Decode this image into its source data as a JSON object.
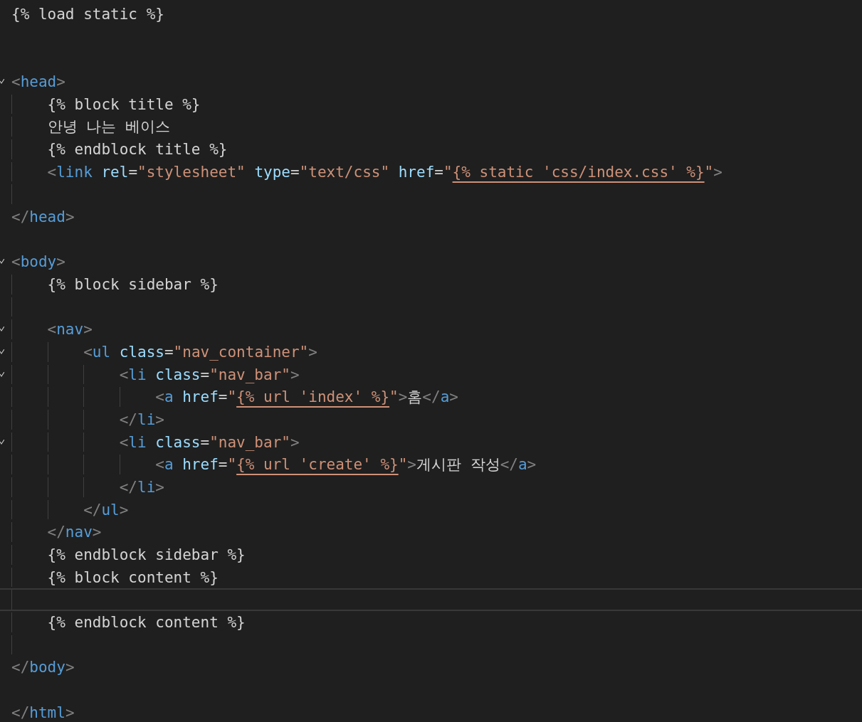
{
  "lines": [
    {
      "foldable": false,
      "current": false,
      "tokens": [
        {
          "kind": "template",
          "text": "{% load static %}"
        }
      ]
    },
    {
      "foldable": false,
      "current": false
    },
    {
      "foldable": false,
      "current": false
    },
    {
      "foldable": true,
      "current": false,
      "tokens": [
        {
          "kind": "bracket",
          "text": "<"
        },
        {
          "kind": "tag",
          "text": "head"
        },
        {
          "kind": "bracket",
          "text": ">"
        }
      ],
      "children": [
        {
          "foldable": false,
          "current": false,
          "tokens": [
            {
              "kind": "template",
              "text": "{% block title %}"
            }
          ]
        },
        {
          "foldable": false,
          "current": false,
          "tokens": [
            {
              "kind": "text",
              "text": "안녕 나는 베이스"
            }
          ]
        },
        {
          "foldable": false,
          "current": false,
          "tokens": [
            {
              "kind": "template",
              "text": "{% endblock title %}"
            }
          ]
        },
        {
          "foldable": false,
          "current": false,
          "tokens": [
            {
              "kind": "bracket",
              "text": "<"
            },
            {
              "kind": "tag",
              "text": "link"
            },
            {
              "kind": "attr",
              "text": " rel"
            },
            {
              "kind": "text",
              "text": "="
            },
            {
              "kind": "string",
              "text": "\"stylesheet\""
            },
            {
              "kind": "attr",
              "text": " type"
            },
            {
              "kind": "text",
              "text": "="
            },
            {
              "kind": "string",
              "text": "\"text/css\""
            },
            {
              "kind": "attr",
              "text": " href"
            },
            {
              "kind": "text",
              "text": "="
            },
            {
              "kind": "string",
              "text": "\""
            },
            {
              "kind": "embedded",
              "text": "{% static 'css/index.css' %}"
            },
            {
              "kind": "string",
              "text": "\""
            },
            {
              "kind": "bracket",
              "text": ">"
            }
          ]
        },
        {
          "foldable": false,
          "current": false
        }
      ]
    },
    {
      "foldable": false,
      "current": false,
      "tokens": [
        {
          "kind": "bracket",
          "text": "</"
        },
        {
          "kind": "tag",
          "text": "head"
        },
        {
          "kind": "bracket",
          "text": ">"
        }
      ]
    },
    {
      "foldable": false,
      "current": false
    },
    {
      "foldable": true,
      "current": false,
      "tokens": [
        {
          "kind": "bracket",
          "text": "<"
        },
        {
          "kind": "tag",
          "text": "body"
        },
        {
          "kind": "bracket",
          "text": ">"
        }
      ],
      "children": [
        {
          "foldable": false,
          "current": false,
          "tokens": [
            {
              "kind": "template",
              "text": "{% block sidebar %}"
            }
          ]
        },
        {
          "foldable": false,
          "current": false
        },
        {
          "foldable": true,
          "current": false,
          "tokens": [
            {
              "kind": "bracket",
              "text": "<"
            },
            {
              "kind": "tag",
              "text": "nav"
            },
            {
              "kind": "bracket",
              "text": ">"
            }
          ],
          "children": [
            {
              "foldable": true,
              "current": false,
              "tokens": [
                {
                  "kind": "bracket",
                  "text": "<"
                },
                {
                  "kind": "tag",
                  "text": "ul"
                },
                {
                  "kind": "attr",
                  "text": " class"
                },
                {
                  "kind": "text",
                  "text": "="
                },
                {
                  "kind": "string",
                  "text": "\"nav_container\""
                },
                {
                  "kind": "bracket",
                  "text": ">"
                }
              ],
              "children": [
                {
                  "foldable": true,
                  "current": false,
                  "tokens": [
                    {
                      "kind": "bracket",
                      "text": "<"
                    },
                    {
                      "kind": "tag",
                      "text": "li"
                    },
                    {
                      "kind": "attr",
                      "text": " class"
                    },
                    {
                      "kind": "text",
                      "text": "="
                    },
                    {
                      "kind": "string",
                      "text": "\"nav_bar\""
                    },
                    {
                      "kind": "bracket",
                      "text": ">"
                    }
                  ],
                  "children": [
                    {
                      "foldable": false,
                      "current": false,
                      "tokens": [
                        {
                          "kind": "bracket",
                          "text": "<"
                        },
                        {
                          "kind": "tag",
                          "text": "a"
                        },
                        {
                          "kind": "attr",
                          "text": " href"
                        },
                        {
                          "kind": "text",
                          "text": "="
                        },
                        {
                          "kind": "string",
                          "text": "\""
                        },
                        {
                          "kind": "embedded",
                          "text": "{% url 'index' %}"
                        },
                        {
                          "kind": "string",
                          "text": "\""
                        },
                        {
                          "kind": "bracket",
                          "text": ">"
                        },
                        {
                          "kind": "text",
                          "text": "홈"
                        },
                        {
                          "kind": "bracket",
                          "text": "</"
                        },
                        {
                          "kind": "tag",
                          "text": "a"
                        },
                        {
                          "kind": "bracket",
                          "text": ">"
                        }
                      ]
                    }
                  ]
                },
                {
                  "foldable": false,
                  "current": false,
                  "tokens": [
                    {
                      "kind": "bracket",
                      "text": "</"
                    },
                    {
                      "kind": "tag",
                      "text": "li"
                    },
                    {
                      "kind": "bracket",
                      "text": ">"
                    }
                  ]
                },
                {
                  "foldable": true,
                  "current": false,
                  "tokens": [
                    {
                      "kind": "bracket",
                      "text": "<"
                    },
                    {
                      "kind": "tag",
                      "text": "li"
                    },
                    {
                      "kind": "attr",
                      "text": " class"
                    },
                    {
                      "kind": "text",
                      "text": "="
                    },
                    {
                      "kind": "string",
                      "text": "\"nav_bar\""
                    },
                    {
                      "kind": "bracket",
                      "text": ">"
                    }
                  ],
                  "children": [
                    {
                      "foldable": false,
                      "current": false,
                      "tokens": [
                        {
                          "kind": "bracket",
                          "text": "<"
                        },
                        {
                          "kind": "tag",
                          "text": "a"
                        },
                        {
                          "kind": "attr",
                          "text": " href"
                        },
                        {
                          "kind": "text",
                          "text": "="
                        },
                        {
                          "kind": "string",
                          "text": "\""
                        },
                        {
                          "kind": "embedded",
                          "text": "{% url 'create' %}"
                        },
                        {
                          "kind": "string",
                          "text": "\""
                        },
                        {
                          "kind": "bracket",
                          "text": ">"
                        },
                        {
                          "kind": "text",
                          "text": "게시판 작성"
                        },
                        {
                          "kind": "bracket",
                          "text": "</"
                        },
                        {
                          "kind": "tag",
                          "text": "a"
                        },
                        {
                          "kind": "bracket",
                          "text": ">"
                        }
                      ]
                    }
                  ]
                },
                {
                  "foldable": false,
                  "current": false,
                  "tokens": [
                    {
                      "kind": "bracket",
                      "text": "</"
                    },
                    {
                      "kind": "tag",
                      "text": "li"
                    },
                    {
                      "kind": "bracket",
                      "text": ">"
                    }
                  ]
                }
              ]
            },
            {
              "foldable": false,
              "current": false,
              "tokens": [
                {
                  "kind": "bracket",
                  "text": "</"
                },
                {
                  "kind": "tag",
                  "text": "ul"
                },
                {
                  "kind": "bracket",
                  "text": ">"
                }
              ]
            }
          ]
        },
        {
          "foldable": false,
          "current": false,
          "tokens": [
            {
              "kind": "bracket",
              "text": "</"
            },
            {
              "kind": "tag",
              "text": "nav"
            },
            {
              "kind": "bracket",
              "text": ">"
            }
          ]
        },
        {
          "foldable": false,
          "current": false,
          "tokens": [
            {
              "kind": "template",
              "text": "{% endblock sidebar %}"
            }
          ]
        },
        {
          "foldable": false,
          "current": false,
          "tokens": [
            {
              "kind": "template",
              "text": "{% block content %}"
            }
          ]
        },
        {
          "foldable": false,
          "current": true
        },
        {
          "foldable": false,
          "current": false,
          "tokens": [
            {
              "kind": "template",
              "text": "{% endblock content %}"
            }
          ]
        },
        {
          "foldable": false,
          "current": false
        }
      ]
    },
    {
      "foldable": false,
      "current": false,
      "tokens": [
        {
          "kind": "bracket",
          "text": "</"
        },
        {
          "kind": "tag",
          "text": "body"
        },
        {
          "kind": "bracket",
          "text": ">"
        }
      ]
    },
    {
      "foldable": false,
      "current": false
    },
    {
      "foldable": false,
      "current": false,
      "tokens": [
        {
          "kind": "bracket",
          "text": "</"
        },
        {
          "kind": "tag",
          "text": "html"
        },
        {
          "kind": "bracket",
          "text": ">"
        }
      ]
    }
  ]
}
